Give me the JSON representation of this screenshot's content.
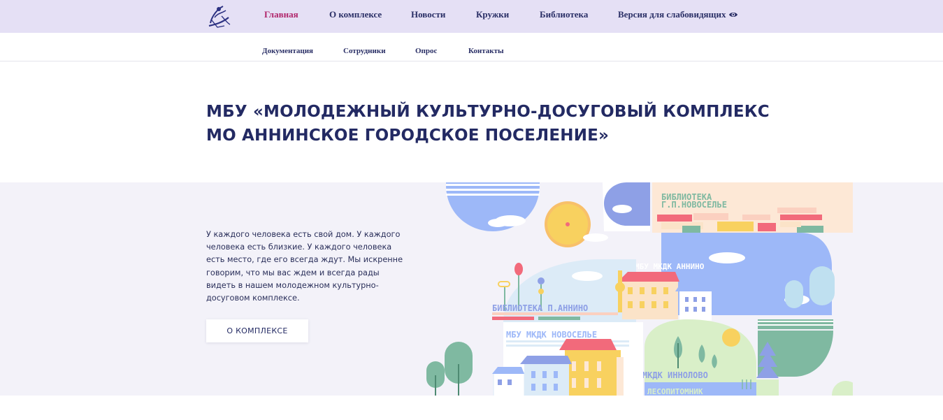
{
  "nav": {
    "items": [
      {
        "label": "Главная",
        "active": true
      },
      {
        "label": "О комплексе"
      },
      {
        "label": "Новости"
      },
      {
        "label": "Кружки"
      },
      {
        "label": "Библиотека"
      },
      {
        "label": "Версия для слабовидящих"
      }
    ],
    "accessibility_icon": "eye-icon",
    "logo_icon": "dancer-logo-icon"
  },
  "subnav": {
    "items": [
      {
        "label": "Документация"
      },
      {
        "label": "Сотрудники"
      },
      {
        "label": "Опрос"
      },
      {
        "label": "Контакты"
      }
    ]
  },
  "title": {
    "line1": "МБУ «МОЛОДЕЖНЫЙ КУЛЬТУРНО-ДОСУГОВЫЙ КОМПЛЕКС",
    "line2": "МО АННИНСКОЕ ГОРОДСКОЕ ПОСЕЛЕНИЕ»"
  },
  "hero": {
    "text": "У каждого человека есть свой дом. У каждого человека есть близкие. У каждого человека есть место, где его всегда ждут. Мы искренне говорим, что мы вас ждем и всегда рады видеть в нашем молодежном культурно-досуговом комплексе.",
    "button_label": "О КОМПЛЕКСЕ"
  },
  "illustration": {
    "labels": {
      "lib_novoselie_1": "БИБЛИОТЕКА",
      "lib_novoselie_2": "Г.П.НОВОСЕЛЬЕ",
      "mkdk_annino": "МБУ МКДК АННИНО",
      "lib_annino": "БИБЛИОТЕКА П.АННИНО",
      "mkdk_novoselie": "МБУ МКДК НОВОСЕЛЬЕ",
      "mkdk_innolovo": "МБУ МКДК ИННОЛОВО",
      "lesopitomnik": "ЛЕСОПИТОМНИК"
    },
    "colors": {
      "blue": "#9db8f8",
      "yellow": "#f8d15f",
      "pink": "#f26a7b",
      "green": "#7fb9a1",
      "purple": "#8ea0e6",
      "peach": "#fde8d6"
    }
  }
}
